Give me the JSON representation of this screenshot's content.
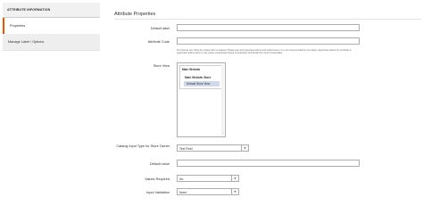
{
  "sidebar": {
    "title": "ATTRIBUTE INFORMATION",
    "items": [
      {
        "label": "Properties"
      },
      {
        "label": "Manage Label / Options"
      }
    ]
  },
  "main": {
    "section_title": "Attribute Properties",
    "fields": {
      "default_label": {
        "label": "Default label",
        "value": ""
      },
      "attribute_code": {
        "label": "Attribute Code",
        "value": "",
        "note": "For internal use. Must be unique with no spaces. Please use only lowercase letters and underscores. It is not recommended to use digits, uppercase letters (or symbols) or uppercase letters since it may cause unexpected issues to properties and break the import functionality."
      },
      "store_view": {
        "label": "Store View",
        "website": "Main Website",
        "store": "Main Website Store",
        "view": "Default Store View"
      },
      "catalog_input_type": {
        "label": "Catalog Input Type for Store Owner",
        "value": "Text Field"
      },
      "default_value": {
        "label": "Default value",
        "value": ""
      },
      "values_required": {
        "label": "Values Required",
        "value": "No"
      },
      "input_validation": {
        "label": "Input Validation",
        "value": "None"
      }
    }
  }
}
